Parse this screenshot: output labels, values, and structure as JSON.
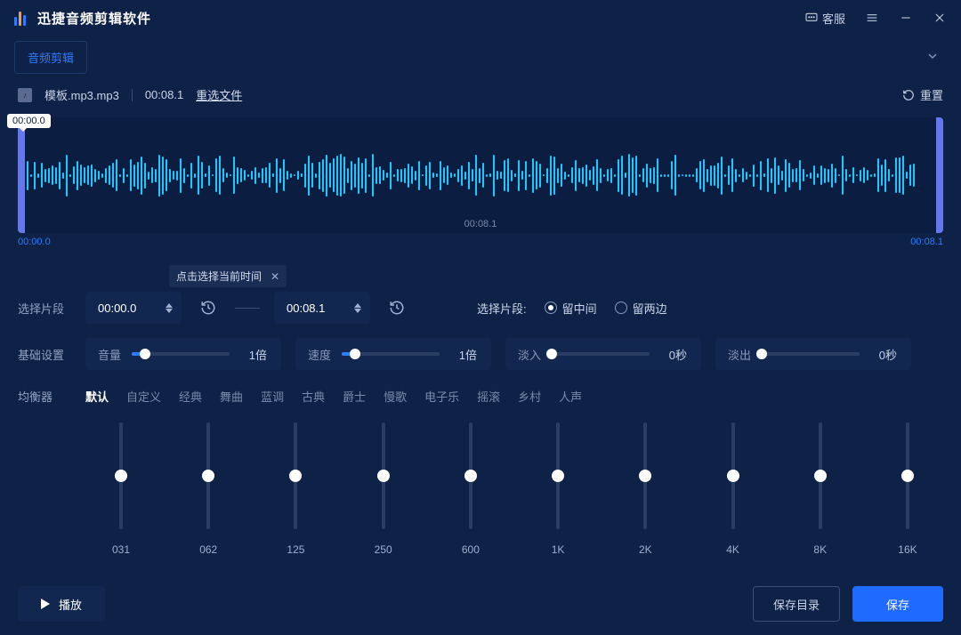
{
  "app": {
    "title": "迅捷音频剪辑软件",
    "kefu": "客服"
  },
  "tabs": {
    "main": "音频剪辑"
  },
  "file": {
    "name": "模板.mp3.mp3",
    "duration": "00:08.1",
    "reselect": "重选文件",
    "reset": "重置"
  },
  "wave": {
    "badge": "00:00.0",
    "tick": "0.2",
    "mid": "00:08.1",
    "start": "00:00.0",
    "end": "00:08.1"
  },
  "tooltip": {
    "text": "点击选择当前时间"
  },
  "segment": {
    "label": "选择片段",
    "from": "00:00.0",
    "to": "00:08.1",
    "keep_label": "选择片段:",
    "keep_mid": "留中间",
    "keep_sides": "留两边"
  },
  "basic": {
    "label": "基础设置",
    "volume": {
      "label": "音量",
      "value": "1倍",
      "pct": 14
    },
    "speed": {
      "label": "速度",
      "value": "1倍",
      "pct": 14
    },
    "fadein": {
      "label": "淡入",
      "value": "0秒",
      "pct": 0
    },
    "fadeout": {
      "label": "淡出",
      "value": "0秒",
      "pct": 0
    }
  },
  "eq": {
    "label": "均衡器",
    "presets": [
      "默认",
      "自定义",
      "经典",
      "舞曲",
      "蓝调",
      "古典",
      "爵士",
      "慢歌",
      "电子乐",
      "摇滚",
      "乡村",
      "人声"
    ],
    "bands": [
      "031",
      "062",
      "125",
      "250",
      "600",
      "1K",
      "2K",
      "4K",
      "8K",
      "16K"
    ]
  },
  "bottom": {
    "play": "播放",
    "save_dir": "保存目录",
    "save": "保存"
  }
}
